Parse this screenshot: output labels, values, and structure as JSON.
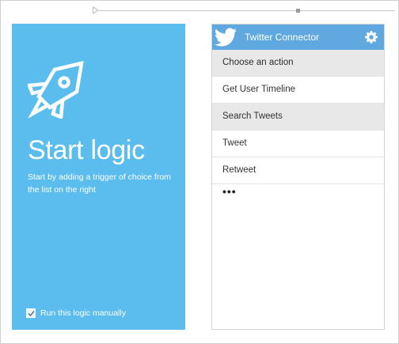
{
  "start": {
    "title": "Start logic",
    "description": "Start by adding a trigger of choice from the list on the right",
    "manual_label": "Run this logic manually",
    "manual_checked": true,
    "background_color": "#5bbdee"
  },
  "connector": {
    "name": "Twitter Connector",
    "icon": "twitter-bird-icon",
    "settings_icon": "gear-icon",
    "header_color": "#5fa9e0",
    "choose_label": "Choose an action",
    "actions": [
      {
        "label": "Get User Timeline",
        "highlighted": false
      },
      {
        "label": "Search Tweets",
        "highlighted": true
      },
      {
        "label": "Tweet",
        "highlighted": false
      },
      {
        "label": "Retweet",
        "highlighted": false
      }
    ],
    "more_label": "•••"
  }
}
